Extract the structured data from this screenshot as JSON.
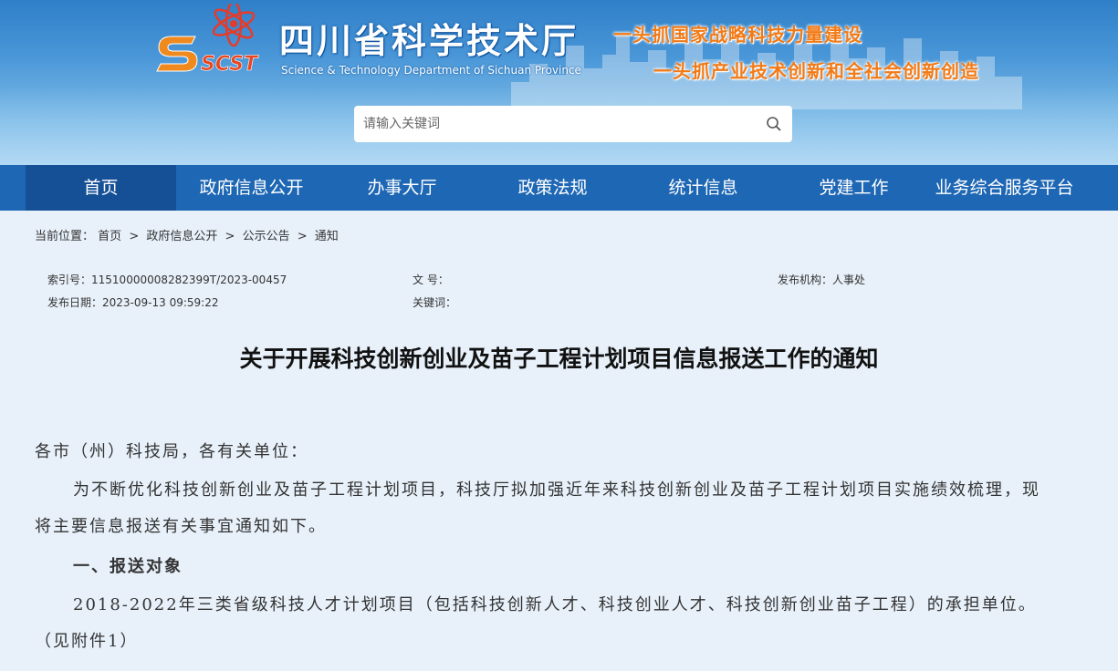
{
  "header": {
    "logo_text": "SCST",
    "title": "四川省科学技术厅",
    "subtitle": "Science & Technology Department of Sichuan Province",
    "slogan_1": "一头抓国家战略科技力量建设",
    "slogan_2": "一头抓产业技术创新和全社会创新创造",
    "search": {
      "placeholder": "请输入关键词"
    }
  },
  "nav": {
    "items": [
      {
        "label": "首页"
      },
      {
        "label": "政府信息公开"
      },
      {
        "label": "办事大厅"
      },
      {
        "label": "政策法规"
      },
      {
        "label": "统计信息"
      },
      {
        "label": "党建工作"
      },
      {
        "label": "业务综合服务平台"
      }
    ]
  },
  "breadcrumb": {
    "prefix": "当前位置：",
    "items": [
      "首页",
      "政府信息公开",
      "公示公告",
      "通知"
    ],
    "separator": ">"
  },
  "meta": {
    "index_label": "索引号：",
    "index_value": "11510000008282399T/2023-00457",
    "doc_no_label": "文 号：",
    "doc_no_value": "",
    "publisher_label": "发布机构：",
    "publisher_value": "人事处",
    "date_label": "发布日期：",
    "date_value": "2023-09-13 09:59:22",
    "keywords_label": "关键词：",
    "keywords_value": ""
  },
  "article": {
    "title": "关于开展科技创新创业及苗子工程计划项目信息报送工作的通知",
    "salutation": "各市（州）科技局，各有关单位：",
    "p1_line1": "为不断优化科技创新创业及苗子工程计划项目，科技厅拟加强近年来科技创新创业及苗子工程计划项目实施绩效梳理，现",
    "p1_line2": "将主要信息报送有关事宜通知如下。",
    "section1": "一、报送对象",
    "p2_line1": "2018-2022年三类省级科技人才计划项目（包括科技创新人才、科技创业人才、科技创新创业苗子工程）的承担单位。",
    "p2_line2": "（见附件1）"
  },
  "colors": {
    "nav_bg": "#1e67b4",
    "nav_active_bg": "#154f95",
    "page_bg": "#e8f1fa",
    "slogan": "#f27a16"
  }
}
